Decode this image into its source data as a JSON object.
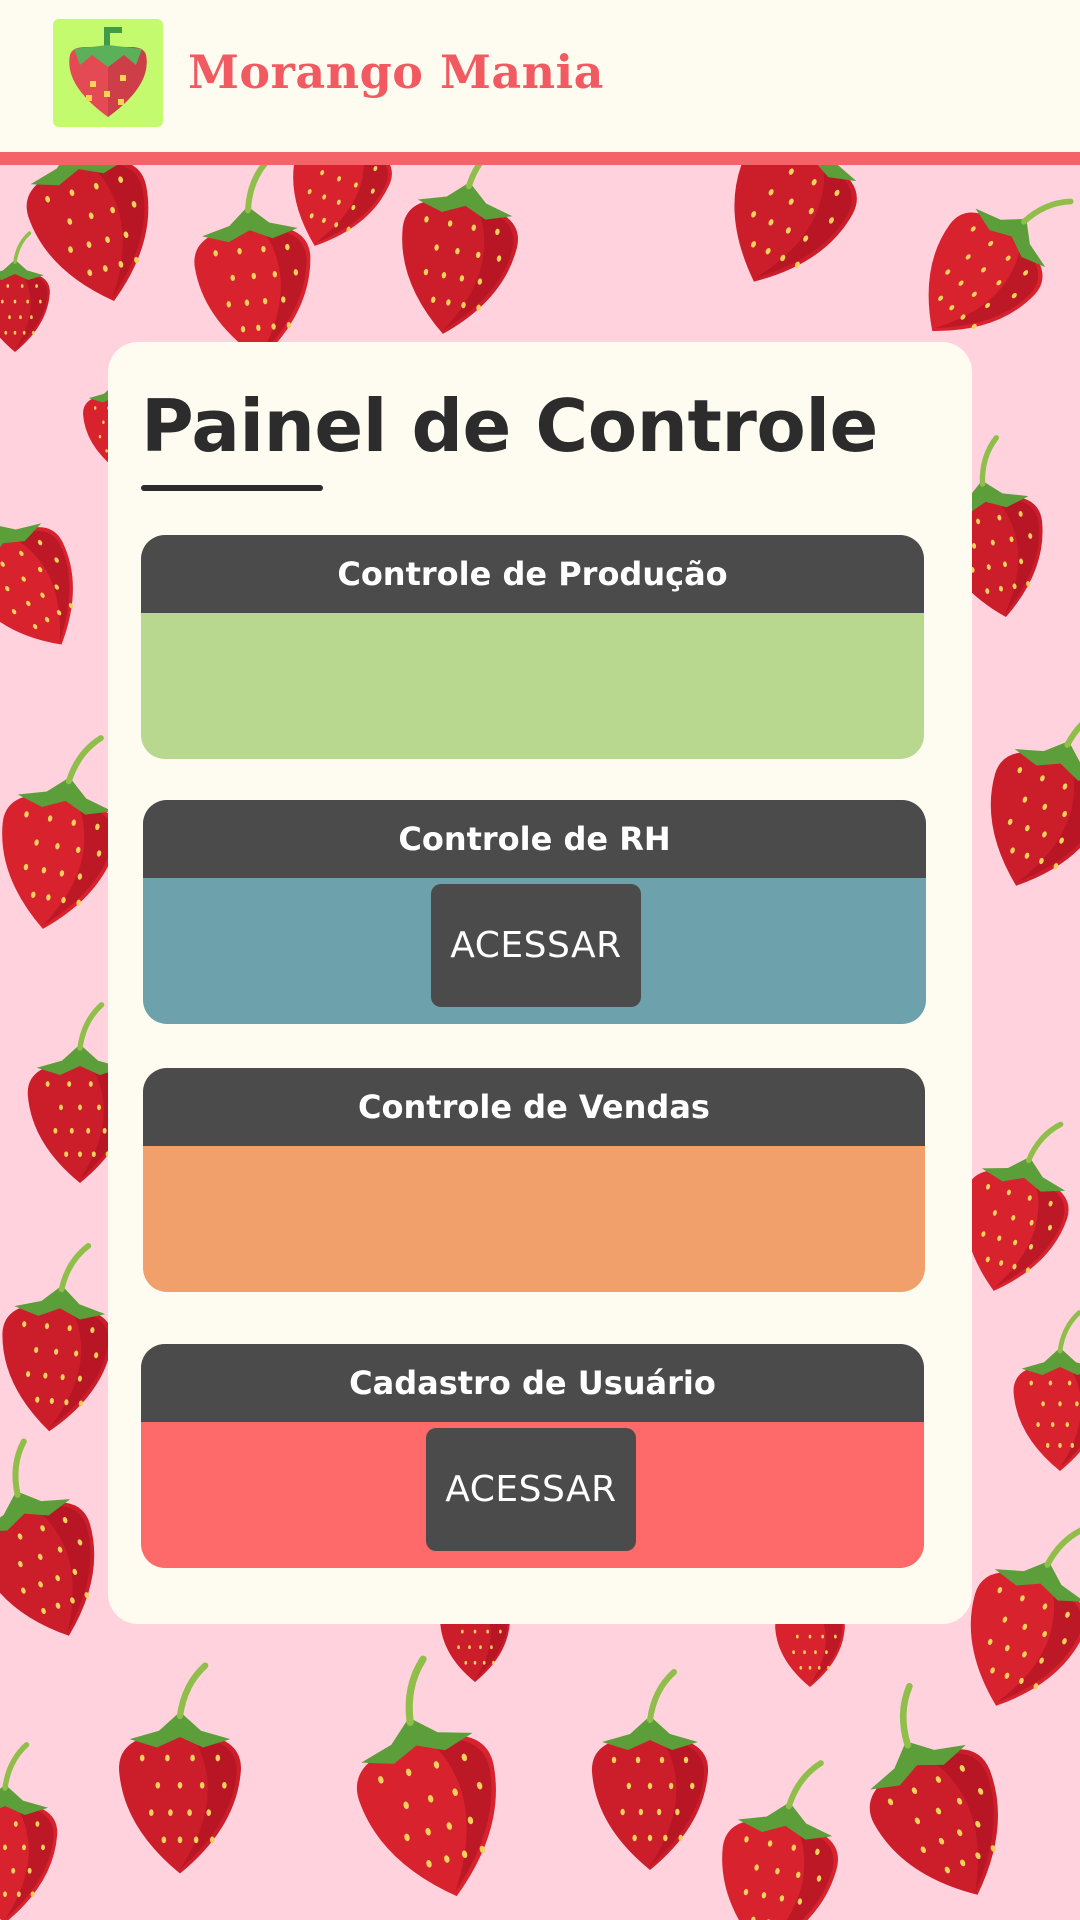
{
  "header": {
    "brand": "Morango Mania",
    "colors": {
      "bar": "#fefcf0",
      "accent_line": "#f46368",
      "logo_bg": "#c4fa6d",
      "brand_text": "#f25a62"
    },
    "logo_icon": "strawberry-icon"
  },
  "background": {
    "color": "#ffd2de",
    "pattern_icon": "strawberry-icon"
  },
  "panel": {
    "title": "Painel de Controle",
    "cards": [
      {
        "title": "Controle de Produção",
        "color": "#b8d78f",
        "button_label": null
      },
      {
        "title": "Controle de RH",
        "color": "#6da2ad",
        "button_label": "ACESSAR"
      },
      {
        "title": "Controle de Vendas",
        "color": "#f1a06b",
        "button_label": null
      },
      {
        "title": "Cadastro de Usuário",
        "color": "#fe6a6a",
        "button_label": "ACESSAR"
      }
    ]
  }
}
